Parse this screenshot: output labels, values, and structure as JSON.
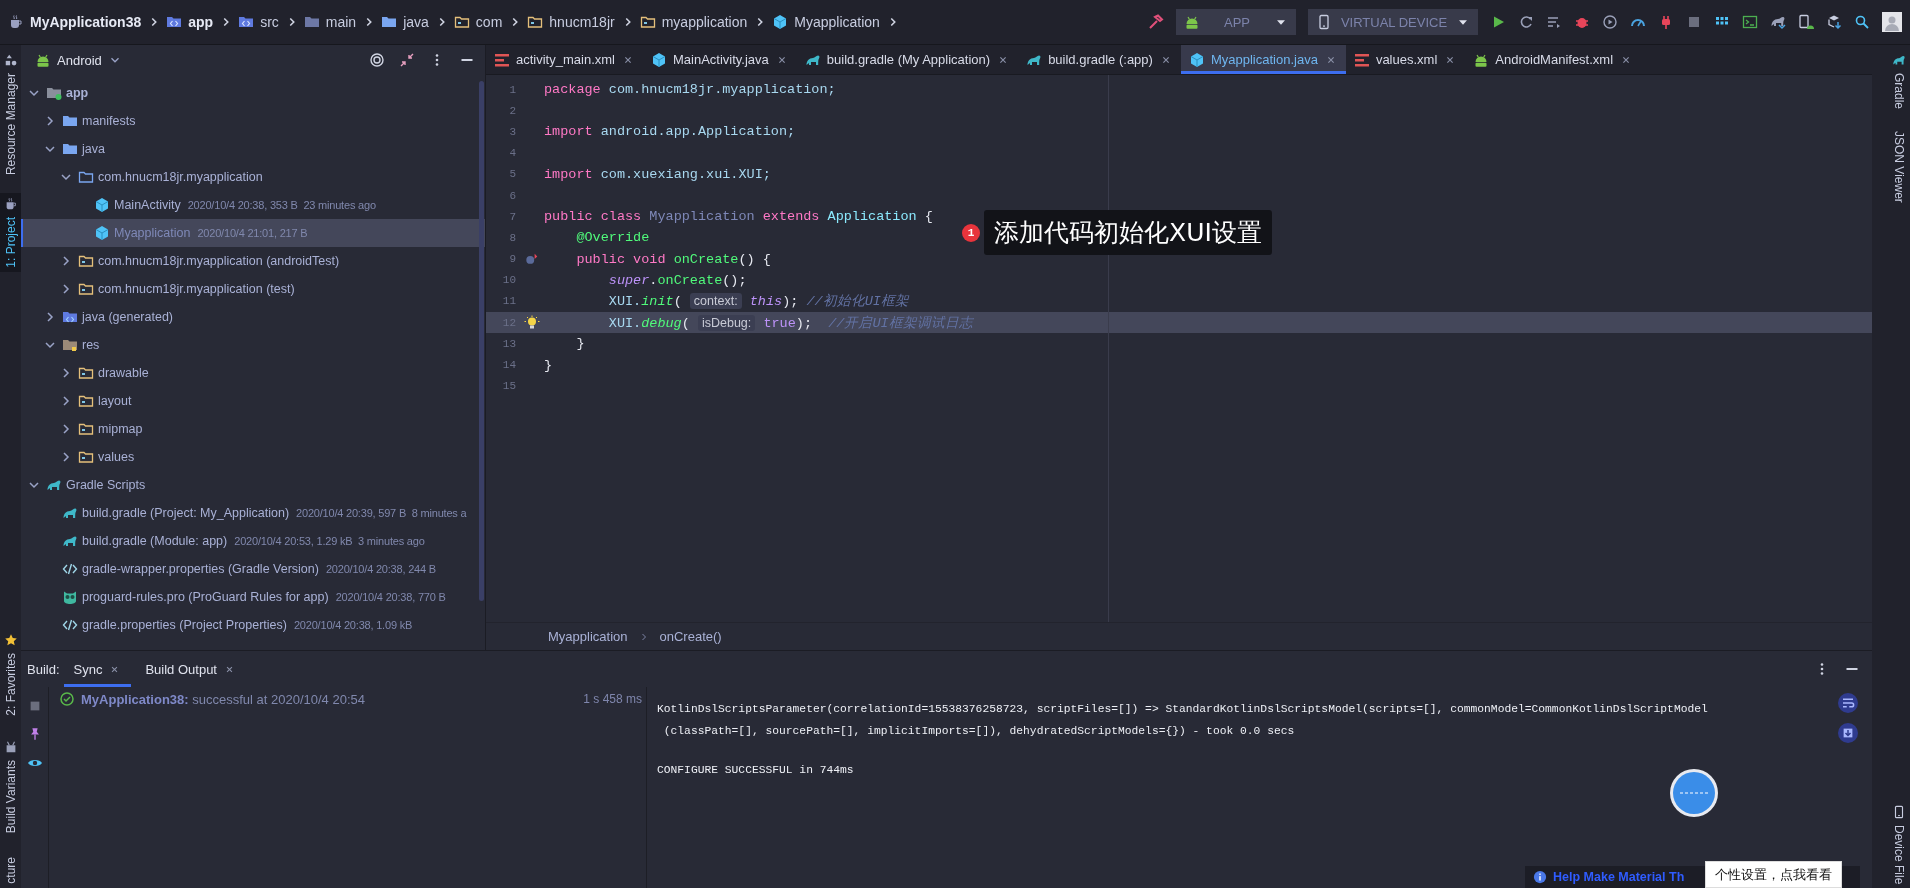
{
  "breadcrumb": [
    {
      "label": "MyApplication38",
      "kind": "project"
    },
    {
      "label": "app",
      "kind": "source"
    },
    {
      "label": "src",
      "kind": "source"
    },
    {
      "label": "main",
      "kind": "folderdark"
    },
    {
      "label": "java",
      "kind": "folder"
    },
    {
      "label": "com",
      "kind": "package"
    },
    {
      "label": "hnucm18jr",
      "kind": "package"
    },
    {
      "label": "myapplication",
      "kind": "package"
    },
    {
      "label": "Myapplication",
      "kind": "class"
    }
  ],
  "toolbar": {
    "config": "APP",
    "device": "VIRTUAL DEVICE"
  },
  "left_stripe": {
    "top": [
      {
        "label": "Resource Manager",
        "kind": "shapes",
        "selected": false
      },
      {
        "label": "1: Project",
        "kind": "project",
        "selected": true
      }
    ],
    "bottom": [
      {
        "label": "2: Favorites",
        "kind": "star",
        "selected": false
      },
      {
        "label": "Build Variants",
        "kind": "variants",
        "selected": false
      },
      {
        "label": "cture",
        "kind": "text",
        "selected": false
      }
    ]
  },
  "right_stripe": {
    "top": [
      {
        "label": "Gradle",
        "kind": "gradle",
        "selected": false
      },
      {
        "label": "JSON Viewer",
        "kind": "text",
        "selected": false
      }
    ],
    "bottom": [
      {
        "label": "Device File",
        "kind": "device",
        "selected": false
      }
    ]
  },
  "project": {
    "view": "Android",
    "tree": [
      {
        "label": "app",
        "kind": "module",
        "bold": true,
        "expanded": true,
        "selected": false,
        "children": [
          {
            "label": "manifests",
            "kind": "folder",
            "expanded": false,
            "selected": false
          },
          {
            "label": "java",
            "kind": "folder",
            "expanded": true,
            "selected": false,
            "children": [
              {
                "label": "com.hnucm18jr.myapplication",
                "kind": "packageblue",
                "expanded": true,
                "selected": false,
                "children": [
                  {
                    "label": "MainActivity",
                    "kind": "class",
                    "meta": "2020/10/4 20:38, 353 B  23 minutes ago",
                    "selected": false
                  },
                  {
                    "label": "Myapplication",
                    "kind": "class",
                    "meta": "2020/10/4 21:01, 217 B",
                    "selected": true
                  }
                ]
              },
              {
                "label": "com.hnucm18jr.myapplication (androidTest)",
                "kind": "package",
                "expanded": false,
                "selected": false
              },
              {
                "label": "com.hnucm18jr.myapplication (test)",
                "kind": "package",
                "expanded": false,
                "selected": false
              }
            ]
          },
          {
            "label": "java (generated)",
            "kind": "generated",
            "expanded": false,
            "selected": false
          },
          {
            "label": "res",
            "kind": "res",
            "expanded": true,
            "selected": false,
            "children": [
              {
                "label": "drawable",
                "kind": "package",
                "expanded": false,
                "selected": false
              },
              {
                "label": "layout",
                "kind": "package",
                "expanded": false,
                "selected": false
              },
              {
                "label": "mipmap",
                "kind": "package",
                "expanded": false,
                "selected": false
              },
              {
                "label": "values",
                "kind": "package",
                "expanded": false,
                "selected": false
              }
            ]
          }
        ]
      },
      {
        "label": "Gradle Scripts",
        "kind": "gradle",
        "expanded": true,
        "selected": false,
        "children": [
          {
            "label": "build.gradle (Project: My_Application)",
            "kind": "gradle",
            "meta": "2020/10/4 20:39, 597 B  8 minutes a",
            "selected": false
          },
          {
            "label": "build.gradle (Module: app)",
            "kind": "gradle",
            "meta": "2020/10/4 20:53, 1.29 kB  3 minutes ago",
            "selected": false
          },
          {
            "label": "gradle-wrapper.properties (Gradle Version)",
            "kind": "props",
            "meta": "2020/10/4 20:38, 244 B",
            "selected": false
          },
          {
            "label": "proguard-rules.pro (ProGuard Rules for app)",
            "kind": "proguard",
            "meta": "2020/10/4 20:38, 770 B",
            "selected": false
          },
          {
            "label": "gradle.properties (Project Properties)",
            "kind": "props",
            "meta": "2020/10/4 20:38, 1.09 kB",
            "selected": false
          }
        ]
      }
    ]
  },
  "editor": {
    "tabs": [
      {
        "label": "activity_main.xml",
        "kind": "xml",
        "closable": true,
        "selected": false
      },
      {
        "label": "MainActivity.java",
        "kind": "class",
        "closable": true,
        "selected": false
      },
      {
        "label": "build.gradle (My Application)",
        "kind": "gradle",
        "closable": true,
        "selected": false
      },
      {
        "label": "build.gradle (:app)",
        "kind": "gradle",
        "closable": true,
        "selected": false
      },
      {
        "label": "Myapplication.java",
        "kind": "class",
        "closable": true,
        "selected": true
      },
      {
        "label": "values.xml",
        "kind": "xml",
        "closable": true,
        "selected": false
      },
      {
        "label": "AndroidManifest.xml",
        "kind": "android",
        "closable": true,
        "selected": false
      }
    ],
    "lines": [
      {
        "number": "1",
        "kind": "plain",
        "highlighted": false,
        "tokens": [
          {
            "kind": "keyword",
            "text": "package "
          },
          {
            "kind": "plain",
            "text": "com.hnucm18jr.myapplication;"
          }
        ]
      },
      {
        "number": "2",
        "kind": "plain",
        "highlighted": false
      },
      {
        "number": "3",
        "kind": "plain",
        "highlighted": false,
        "tokens": [
          {
            "kind": "keyword",
            "text": "import "
          },
          {
            "kind": "plain",
            "text": "android.app.Application;"
          }
        ]
      },
      {
        "number": "4",
        "kind": "plain",
        "highlighted": false
      },
      {
        "number": "5",
        "kind": "plain",
        "highlighted": false,
        "tokens": [
          {
            "kind": "keyword",
            "text": "import "
          },
          {
            "kind": "plain",
            "text": "com.xuexiang.xui.XUI;"
          }
        ]
      },
      {
        "number": "6",
        "kind": "plain",
        "highlighted": false
      },
      {
        "number": "7",
        "kind": "plain",
        "highlighted": false,
        "tokens": [
          {
            "kind": "keyword",
            "text": "public class "
          },
          {
            "kind": "classname",
            "text": "Myapplication "
          },
          {
            "kind": "keyword",
            "text": "extends "
          },
          {
            "kind": "type",
            "text": "Application "
          },
          {
            "kind": "brace",
            "text": "{"
          }
        ]
      },
      {
        "number": "8",
        "kind": "plain",
        "highlighted": false,
        "tokens": [
          {
            "kind": "annotation",
            "text": "    @Override"
          }
        ]
      },
      {
        "number": "9",
        "kind": "override",
        "highlighted": false,
        "tokens": [
          {
            "kind": "keyword",
            "text": "    public void "
          },
          {
            "kind": "method",
            "text": "onCreate"
          },
          {
            "kind": "brace",
            "text": "() {"
          }
        ]
      },
      {
        "number": "10",
        "kind": "plain",
        "highlighted": false,
        "tokens": [
          {
            "kind": "self",
            "text": "        super"
          },
          {
            "kind": "brace",
            "text": "."
          },
          {
            "kind": "method",
            "text": "onCreate"
          },
          {
            "kind": "brace",
            "text": "();"
          }
        ]
      },
      {
        "number": "11",
        "kind": "plain",
        "highlighted": false,
        "tokens": [
          {
            "kind": "plain",
            "text": "        XUI."
          },
          {
            "kind": "call",
            "text": "init"
          },
          {
            "kind": "brace",
            "text": "( "
          },
          {
            "kind": "hint",
            "text": "context:"
          },
          {
            "kind": "self",
            "text": " this"
          },
          {
            "kind": "brace",
            "text": "); "
          },
          {
            "kind": "comment",
            "text": "//初始化UI框架"
          }
        ]
      },
      {
        "number": "12",
        "kind": "bulb",
        "highlighted": true,
        "tokens": [
          {
            "kind": "plain",
            "text": "        XUI."
          },
          {
            "kind": "call",
            "text": "debug"
          },
          {
            "kind": "brace",
            "text": "( "
          },
          {
            "kind": "hint",
            "text": "isDebug:"
          },
          {
            "kind": "value",
            "text": " true"
          },
          {
            "kind": "brace",
            "text": ");  "
          },
          {
            "kind": "comment",
            "text": "//开启UI框架调试日志"
          }
        ]
      },
      {
        "number": "13",
        "kind": "plain",
        "highlighted": false,
        "tokens": [
          {
            "kind": "brace",
            "text": "    }"
          }
        ]
      },
      {
        "number": "14",
        "kind": "plain",
        "highlighted": false,
        "tokens": [
          {
            "kind": "brace",
            "text": "}"
          }
        ]
      },
      {
        "number": "15",
        "kind": "plain",
        "highlighted": false
      }
    ],
    "footer": [
      "Myapplication",
      "onCreate()"
    ],
    "callout": {
      "badge": "1",
      "text": "添加代码初始化XUI设置"
    }
  },
  "build": {
    "label": "Build:",
    "tabs": [
      {
        "label": "Sync",
        "selected": true
      },
      {
        "label": "Build Output",
        "selected": false
      }
    ],
    "result": {
      "kind": "success",
      "text": "**MyApplication38:** successful at 2020/10/4 20:54",
      "duration": "1 s 458 ms"
    },
    "console": [
      [
        "KotlinDslScriptsParameter(correlationId=15538376258723, scriptFiles=[]) => StandardKotlinDslScriptsModel(scripts=[], commonModel=CommonKotlinDslScriptModel",
        " (classPath=[], sourcePath=[], implicitImports=[]), dehydratedScriptModels={}) - took 0.0 secs"
      ],
      [
        "CONFIGURE SUCCESSFUL in 744ms"
      ]
    ]
  },
  "notification": {
    "text": "Help Make Material Th"
  },
  "tooltip": {
    "text": "个性设置，点我看看"
  }
}
